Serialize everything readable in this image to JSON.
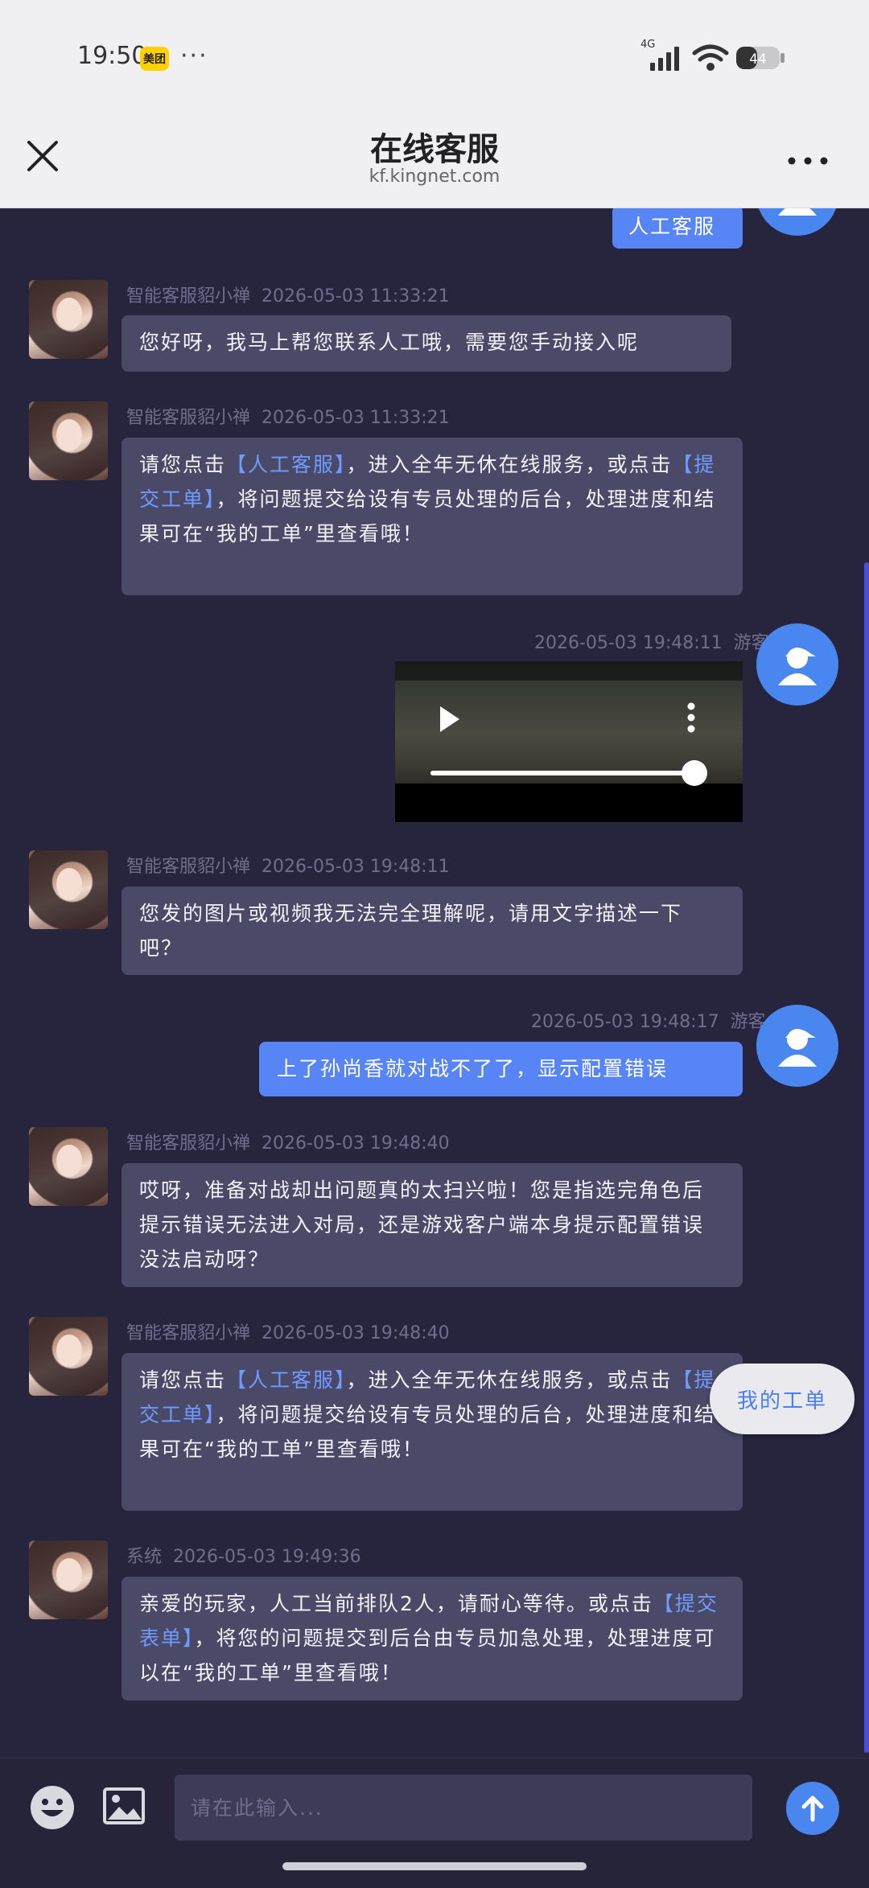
{
  "status_bar": {
    "time": "19:50",
    "app_badge": "美团",
    "dots": "···",
    "network": "4G",
    "battery": "44"
  },
  "header": {
    "title": "在线客服",
    "subtitle": "kf.kingnet.com"
  },
  "messages": [
    {
      "sender": "",
      "time": "",
      "text": "人工客服"
    },
    {
      "sender": "智能客服貂小禅",
      "time": "2026-05-03 11:33:21",
      "text": "您好呀，我马上帮您联系人工哦，需要您手动接入呢"
    },
    {
      "sender": "智能客服貂小禅",
      "time": "2026-05-03 11:33:21",
      "pre1": "请您点击",
      "link1": "【人工客服】",
      "mid1": "，进入全年无休在线服务，或点击",
      "link2": "【提交工单】",
      "post": "，将问题提交给设有专员处理的后台，处理进度和结果可在“我的工单”里查看哦！"
    },
    {
      "sender": "游客",
      "time": "2026-05-03 19:48:11"
    },
    {
      "sender": "智能客服貂小禅",
      "time": "2026-05-03 19:48:11",
      "text": "您发的图片或视频我无法完全理解呢，请用文字描述一下吧？"
    },
    {
      "sender": "游客",
      "time": "2026-05-03 19:48:17",
      "text": "上了孙尚香就对战不了了，显示配置错误"
    },
    {
      "sender": "智能客服貂小禅",
      "time": "2026-05-03 19:48:40",
      "text": "哎呀，准备对战却出问题真的太扫兴啦！您是指选完角色后提示错误无法进入对局，还是游戏客户端本身提示配置错误没法启动呀？"
    },
    {
      "sender": "智能客服貂小禅",
      "time": "2026-05-03 19:48:40",
      "pre1": "请您点击",
      "link1": "【人工客服】",
      "mid1": "，进入全年无休在线服务，或点击",
      "link2": "【提交工单】",
      "post": "，将问题提交给设有专员处理的后台，处理进度和结果可在“我的工单”里查看哦！"
    },
    {
      "sender": "系统",
      "time": "2026-05-03 19:49:36",
      "pre1": "亲爱的玩家，人工当前排队2人，请耐心等待。或点击",
      "link1": "【提交表单】",
      "post": "，将您的问题提交到后台由专员加急处理，处理进度可以在“我的工单”里查看哦！"
    }
  ],
  "floating_button": "我的工单",
  "input": {
    "placeholder": "请在此输入..."
  },
  "colors": {
    "background": "#26253d",
    "bot_bubble": "#4a4968",
    "user_bubble": "#5785f5",
    "link": "#6f9bff",
    "accent": "#4a86f0"
  },
  "icons": [
    "close-icon",
    "more-icon",
    "play-icon",
    "emoji-icon",
    "image-icon",
    "send-arrow-icon"
  ]
}
